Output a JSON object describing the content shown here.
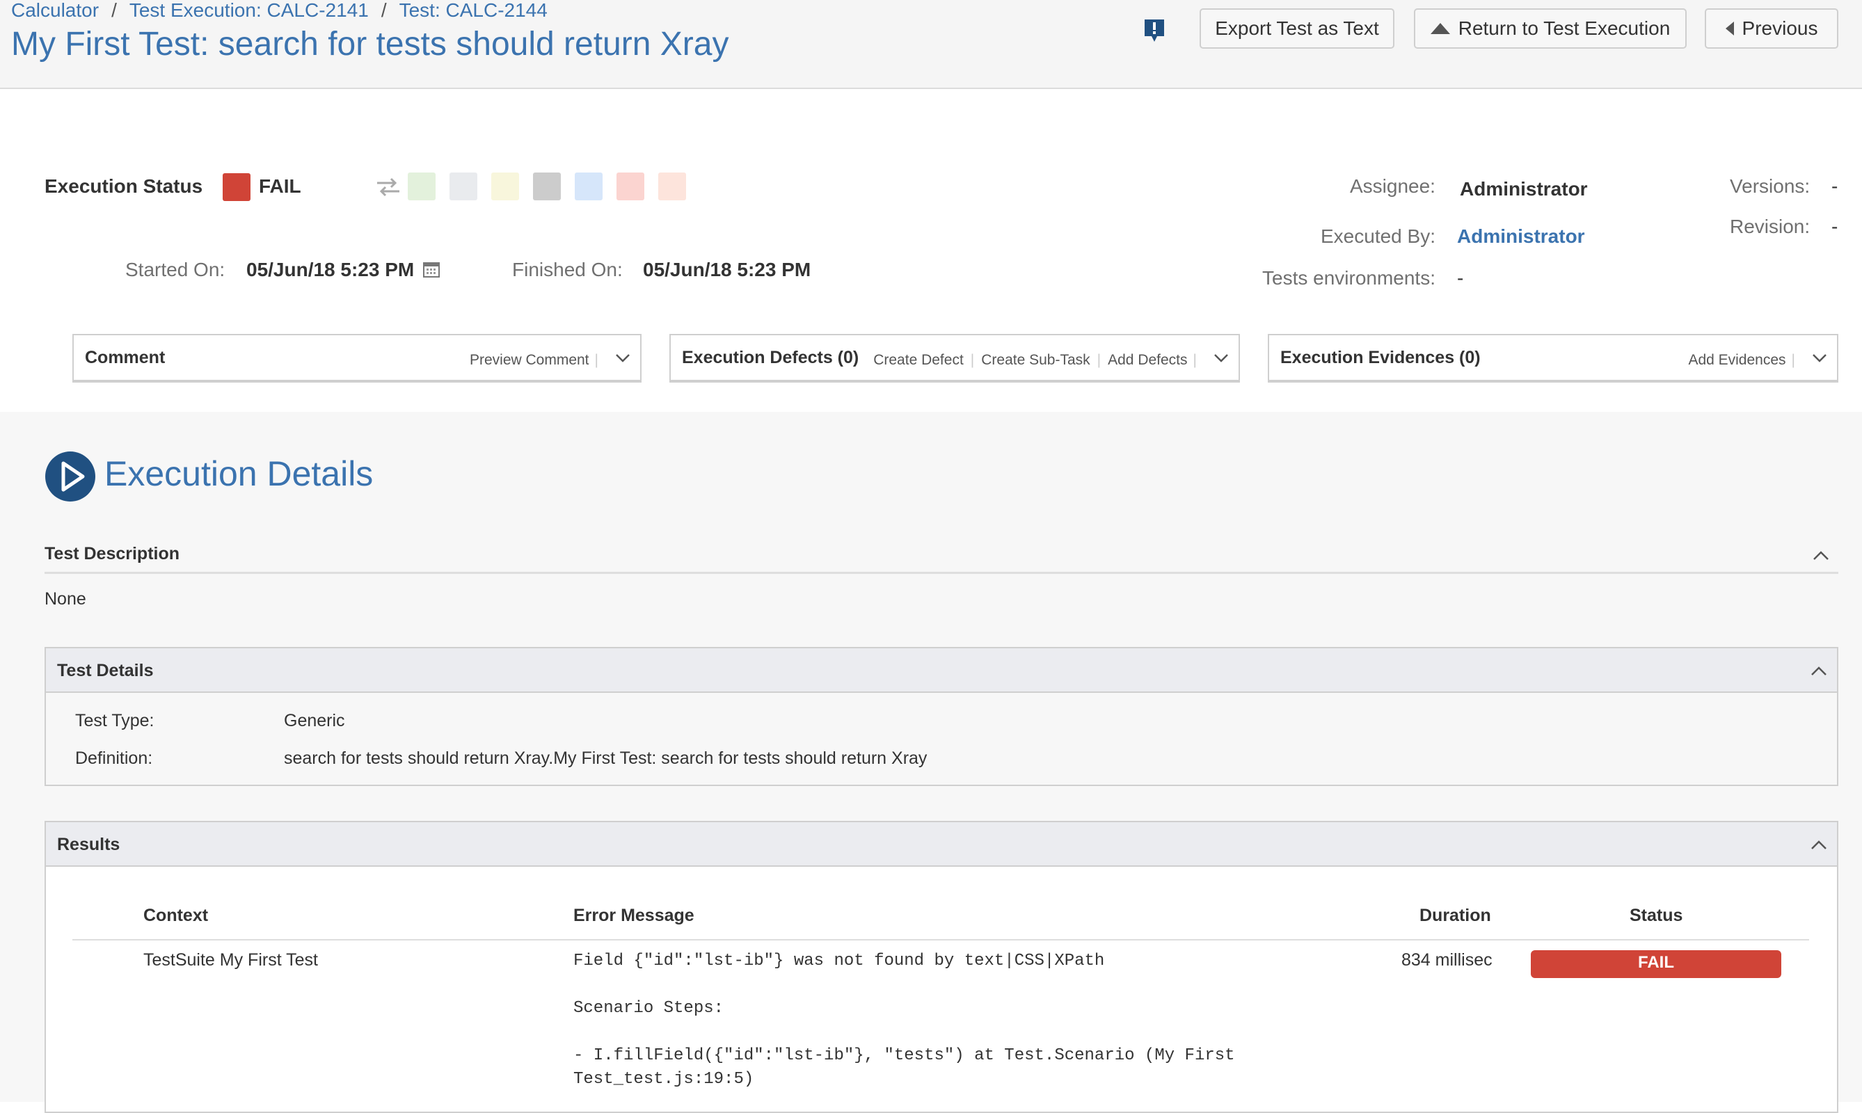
{
  "breadcrumb": [
    "Calculator",
    "Test Execution: CALC-2141",
    "Test: CALC-2144"
  ],
  "page_title": "My First Test: search for tests should return Xray",
  "toolbar": {
    "export_label": "Export Test as Text",
    "return_label": "Return to Test Execution",
    "previous_label": "Previous"
  },
  "execution": {
    "status_label": "Execution Status",
    "status_value": "FAIL",
    "status_color": "#d04437",
    "other_status_colors": [
      "#e3f1dc",
      "#e9ebee",
      "#f8f6dc",
      "#cccccc",
      "#d6e6fa",
      "#fbd4d0",
      "#fde4dc"
    ],
    "started_label": "Started On:",
    "started_value": "05/Jun/18 5:23 PM",
    "finished_label": "Finished On:",
    "finished_value": "05/Jun/18 5:23 PM",
    "assignee_label": "Assignee:",
    "assignee_value": "Administrator",
    "executed_by_label": "Executed By:",
    "executed_by_value": "Administrator",
    "environments_label": "Tests environments:",
    "environments_value": "-",
    "versions_label": "Versions:",
    "versions_value": "-",
    "revision_label": "Revision:",
    "revision_value": "-"
  },
  "panels": {
    "comment": {
      "title": "Comment",
      "actions": [
        "Preview Comment"
      ]
    },
    "defects": {
      "title": "Execution Defects (0)",
      "actions": [
        "Create Defect",
        "Create Sub-Task",
        "Add Defects"
      ]
    },
    "evidences": {
      "title": "Execution Evidences (0)",
      "actions": [
        "Add Evidences"
      ]
    }
  },
  "details": {
    "heading": "Execution Details",
    "description_title": "Test Description",
    "description_value": "None",
    "test_details_title": "Test Details",
    "test_type_label": "Test Type:",
    "test_type_value": "Generic",
    "definition_label": "Definition:",
    "definition_value": "search for tests should return Xray.My First Test: search for tests should return Xray"
  },
  "results": {
    "title": "Results",
    "columns": [
      "Context",
      "Error Message",
      "Duration",
      "Status"
    ],
    "rows": [
      {
        "context": "TestSuite My First Test",
        "error_line1": "Field {\"id\":\"lst-ib\"} was not found by text|CSS|XPath",
        "error_line2": "Scenario Steps:",
        "error_line3": "- I.fillField({\"id\":\"lst-ib\"}, \"tests\") at Test.Scenario (My First",
        "error_line4": "Test_test.js:19:5)",
        "duration": "834 millisec",
        "status": "FAIL"
      }
    ]
  },
  "icons": [
    "feedback-icon",
    "triangle-up-icon",
    "triangle-left-icon",
    "swap-arrows-icon",
    "calendar-icon",
    "chevron-down-icon",
    "play-circle-icon",
    "chevron-up-icon"
  ]
}
